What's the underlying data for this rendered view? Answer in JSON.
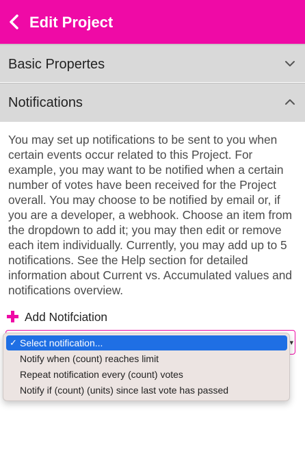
{
  "header": {
    "title": "Edit Project",
    "background": "#ef0aa6",
    "back_icon": "chevron-left-icon"
  },
  "sections": {
    "basic": {
      "title": "Basic Propertes",
      "expanded": false,
      "icon": "chevron-down-icon"
    },
    "notifications": {
      "title": "Notifications",
      "expanded": true,
      "icon": "chevron-up-icon"
    }
  },
  "notifications": {
    "description": "You may set up notifications to be sent to you when certain events occur related to this Project.  For example, you may want to be notified when a certain number of votes have been received for the Project overall.  You may choose to be notified by email or, if you are a developer, a webhook.  Choose an item from the dropdown to add it; you may then edit or remove each item individually. Currently, you may add up to 5 notifications. See the Help section for detailed information about Current vs. Accumulated values and notifications overview.",
    "add_label": "Add Notifciation",
    "add_icon": "plus-icon"
  },
  "dropdown": {
    "check_mark": "✓",
    "options": [
      {
        "label": "Select notification...",
        "selected": true
      },
      {
        "label": "Notify when (count) reaches limit",
        "selected": false
      },
      {
        "label": "Repeat notification every (count) votes",
        "selected": false
      },
      {
        "label": "Notify if (count) (units) since last vote has passed",
        "selected": false
      }
    ],
    "selected_color": "#1f6fe4"
  }
}
